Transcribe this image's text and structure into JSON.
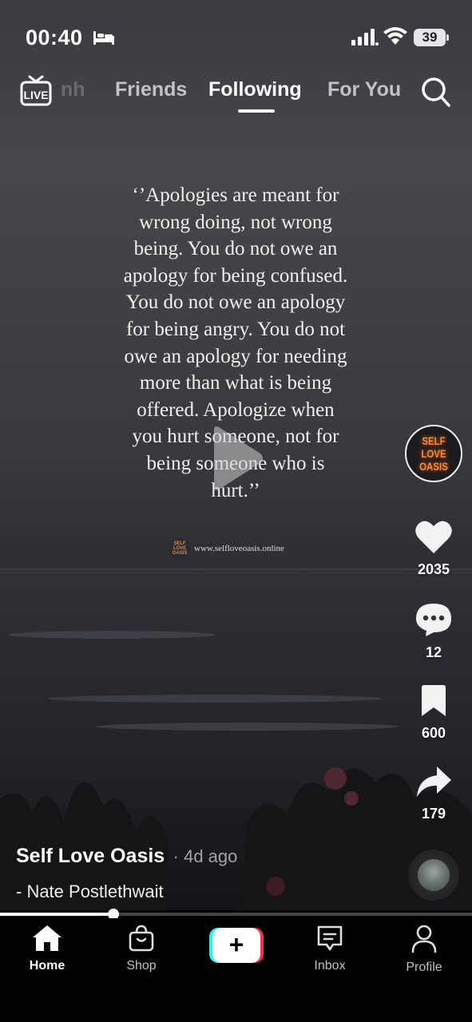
{
  "status_bar": {
    "time": "00:40",
    "battery": "39",
    "icons": [
      "bed-icon",
      "cellular-signal-icon",
      "wifi-icon",
      "battery-icon"
    ]
  },
  "top_nav": {
    "live_label": "LIVE",
    "tabs": [
      {
        "label": "nh",
        "state": "partial"
      },
      {
        "label": "Friends",
        "state": "inactive"
      },
      {
        "label": "Following",
        "state": "active"
      },
      {
        "label": "For You",
        "state": "inactive"
      }
    ],
    "search_icon": "search-icon"
  },
  "video": {
    "quote_lines": [
      "‘’Apologies are meant for",
      "wrong doing, not wrong",
      "being. You do not owe an",
      "apology for being confused.",
      "You do not owe an apology",
      "for being angry. You do not",
      "owe an apology for needing",
      "more than what is being",
      "offered. Apologize when",
      "you hurt someone, not for",
      "being someone who is",
      "hurt.’’"
    ],
    "watermark_logo": "SELF LOVE OASIS",
    "watermark_url": "www.selfloveoasis.online",
    "paused": true
  },
  "actions": {
    "creator_avatar_text": "SELF LOVE OASIS",
    "likes": "2035",
    "comments": "12",
    "saves": "600",
    "shares": "179"
  },
  "caption": {
    "creator": "Self Love Oasis",
    "age": "· 4d ago",
    "description": "- Nate Postlethwait"
  },
  "playback": {
    "progress_fraction": 0.24
  },
  "bottom_nav": {
    "home": "Home",
    "shop": "Shop",
    "inbox": "Inbox",
    "profile": "Profile",
    "create_symbol": "+"
  },
  "colors": {
    "brand_cyan": "#25f4ee",
    "brand_pink": "#fe2c55",
    "avatar_text": "#f48a3a"
  }
}
